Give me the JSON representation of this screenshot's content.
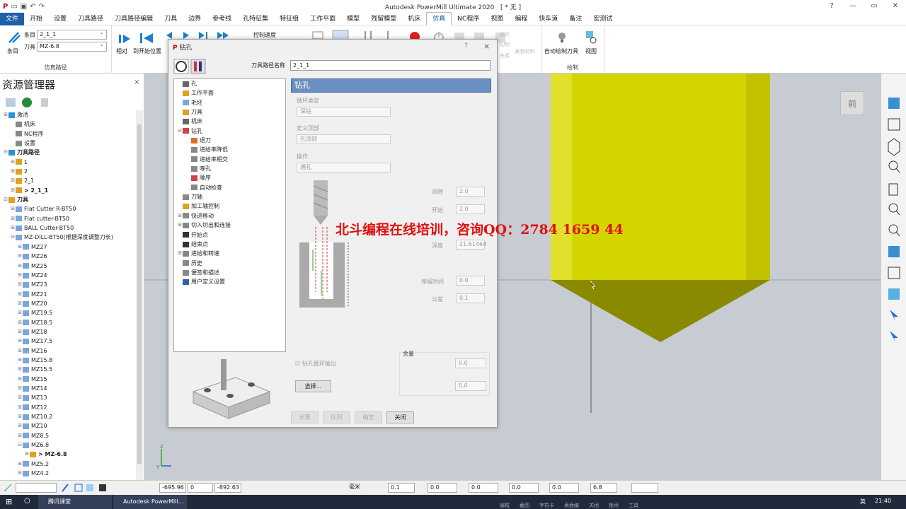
{
  "window": {
    "title": "Autodesk PowerMill Ultimate 2020",
    "doc": "[ * 无 ]"
  },
  "menu": [
    "文件",
    "开始",
    "设置",
    "刀具路径",
    "刀具路径编辑",
    "刀具",
    "边界",
    "参考线",
    "孔特征集",
    "特征组",
    "工作平面",
    "模型",
    "残留模型",
    "机床",
    "仿真",
    "NC程序",
    "视图",
    "编程",
    "快车道",
    "备注",
    "宏测试"
  ],
  "ribbon": {
    "item_label": "条目",
    "item_value": "2_1_1",
    "tool_label": "刀具",
    "tool_value": "MZ-6.8",
    "entry_btn": "条目",
    "sim_path_group": "仿真路径",
    "relative": "相对",
    "to_start": "到开始位置",
    "control_speed": "控制速度",
    "auto_draw": "自动绘制刀具",
    "view": "视图",
    "draw_group": "绘制",
    "ghost1": "操作",
    "ghost2": "切削",
    "ghost3": "刷新材料",
    "ghost4": "夹紧"
  },
  "explorer": {
    "title": "资源管理器",
    "tree": [
      {
        "indent": 0,
        "exp": "⊞",
        "label": "激活",
        "icon": "#2f8fd8"
      },
      {
        "indent": 1,
        "exp": "",
        "label": "机床",
        "icon": "#888"
      },
      {
        "indent": 1,
        "exp": "",
        "label": "NC程序",
        "icon": "#888"
      },
      {
        "indent": 1,
        "exp": "",
        "label": "设置",
        "icon": "#888"
      },
      {
        "indent": 0,
        "exp": "⊟",
        "label": "刀具路径",
        "icon": "#2f8fd8",
        "bold": true
      },
      {
        "indent": 1,
        "exp": "⊞",
        "label": "1",
        "icon": "#e0a020"
      },
      {
        "indent": 1,
        "exp": "⊞",
        "label": "2",
        "icon": "#e0a020"
      },
      {
        "indent": 1,
        "exp": "⊞",
        "label": "2_1",
        "icon": "#e0a020"
      },
      {
        "indent": 1,
        "exp": "⊞",
        "label": "> 2_1_1",
        "icon": "#e0a020",
        "bold": true
      },
      {
        "indent": 0,
        "exp": "⊟",
        "label": "刀具",
        "icon": "#e0a020",
        "bold": true
      },
      {
        "indent": 1,
        "exp": "⊞",
        "label": "Flat Cutter R-BT50",
        "icon": "#7aa6d8"
      },
      {
        "indent": 1,
        "exp": "⊞",
        "label": "Flat cutter-BT50",
        "icon": "#7aa6d8"
      },
      {
        "indent": 1,
        "exp": "⊞",
        "label": "BALL Cutter-BT50",
        "icon": "#7aa6d8"
      },
      {
        "indent": 1,
        "exp": "⊟",
        "label": "MZ-DILL-BT50(根据深度调整刀长)",
        "icon": "#7aa6d8"
      },
      {
        "indent": 2,
        "exp": "⊞",
        "label": "MZ27",
        "icon": "#7aa6d8"
      },
      {
        "indent": 2,
        "exp": "⊞",
        "label": "MZ26",
        "icon": "#7aa6d8"
      },
      {
        "indent": 2,
        "exp": "⊞",
        "label": "MZ25",
        "icon": "#7aa6d8"
      },
      {
        "indent": 2,
        "exp": "⊞",
        "label": "MZ24",
        "icon": "#7aa6d8"
      },
      {
        "indent": 2,
        "exp": "⊞",
        "label": "MZ23",
        "icon": "#7aa6d8"
      },
      {
        "indent": 2,
        "exp": "⊞",
        "label": "MZ21",
        "icon": "#7aa6d8"
      },
      {
        "indent": 2,
        "exp": "⊞",
        "label": "MZ20",
        "icon": "#7aa6d8"
      },
      {
        "indent": 2,
        "exp": "⊞",
        "label": "MZ19.5",
        "icon": "#7aa6d8"
      },
      {
        "indent": 2,
        "exp": "⊞",
        "label": "MZ18.5",
        "icon": "#7aa6d8"
      },
      {
        "indent": 2,
        "exp": "⊞",
        "label": "MZ18",
        "icon": "#7aa6d8"
      },
      {
        "indent": 2,
        "exp": "⊞",
        "label": "MZ17.5",
        "icon": "#7aa6d8"
      },
      {
        "indent": 2,
        "exp": "⊞",
        "label": "MZ16",
        "icon": "#7aa6d8"
      },
      {
        "indent": 2,
        "exp": "⊞",
        "label": "MZ15.8",
        "icon": "#7aa6d8"
      },
      {
        "indent": 2,
        "exp": "⊞",
        "label": "MZ15.5",
        "icon": "#7aa6d8"
      },
      {
        "indent": 2,
        "exp": "⊞",
        "label": "MZ15",
        "icon": "#7aa6d8"
      },
      {
        "indent": 2,
        "exp": "⊞",
        "label": "MZ14",
        "icon": "#7aa6d8"
      },
      {
        "indent": 2,
        "exp": "⊞",
        "label": "MZ13",
        "icon": "#7aa6d8"
      },
      {
        "indent": 2,
        "exp": "⊞",
        "label": "MZ12",
        "icon": "#7aa6d8"
      },
      {
        "indent": 2,
        "exp": "⊞",
        "label": "MZ10.2",
        "icon": "#7aa6d8"
      },
      {
        "indent": 2,
        "exp": "⊞",
        "label": "MZ10",
        "icon": "#7aa6d8"
      },
      {
        "indent": 2,
        "exp": "⊞",
        "label": "MZ8.5",
        "icon": "#7aa6d8"
      },
      {
        "indent": 2,
        "exp": "⊟",
        "label": "MZ6.8",
        "icon": "#7aa6d8"
      },
      {
        "indent": 3,
        "exp": "⊞",
        "label": "> MZ-6.8",
        "icon": "#e0a020",
        "bold": true
      },
      {
        "indent": 2,
        "exp": "⊞",
        "label": "MZ5.2",
        "icon": "#7aa6d8"
      },
      {
        "indent": 2,
        "exp": "⊞",
        "label": "MZ4.2",
        "icon": "#7aa6d8"
      }
    ]
  },
  "dialog": {
    "title": "钻孔",
    "path_name_label": "刀具路径名称",
    "path_name_value": "2_1_1",
    "section_title": "钻孔",
    "tree": [
      {
        "indent": 0,
        "label": "孔",
        "icon": "#666"
      },
      {
        "indent": 0,
        "label": "工作平面",
        "icon": "#e0a020"
      },
      {
        "indent": 0,
        "label": "毛坯",
        "icon": "#7aa6d8"
      },
      {
        "indent": 0,
        "label": "刀具",
        "icon": "#e0a020"
      },
      {
        "indent": 0,
        "label": "机床",
        "icon": "#666"
      },
      {
        "indent": 0,
        "label": "钻孔",
        "icon": "#c44",
        "exp": "⊟"
      },
      {
        "indent": 1,
        "label": "退刀",
        "icon": "#e07020"
      },
      {
        "indent": 1,
        "label": "进给率降低",
        "icon": "#888"
      },
      {
        "indent": 1,
        "label": "进给率相交",
        "icon": "#888"
      },
      {
        "indent": 1,
        "label": "啄孔",
        "icon": "#888"
      },
      {
        "indent": 1,
        "label": "顺序",
        "icon": "#c44"
      },
      {
        "indent": 1,
        "label": "自动检查",
        "icon": "#888"
      },
      {
        "indent": 0,
        "label": "刀轴",
        "icon": "#888"
      },
      {
        "indent": 0,
        "label": "加工轴控制",
        "icon": "#e0a020"
      },
      {
        "indent": 0,
        "label": "快进移动",
        "icon": "#888",
        "exp": "⊞"
      },
      {
        "indent": 0,
        "label": "切入切出和连接",
        "icon": "#888",
        "exp": "⊞"
      },
      {
        "indent": 0,
        "label": "开始点",
        "icon": "#333"
      },
      {
        "indent": 0,
        "label": "结束点",
        "icon": "#333"
      },
      {
        "indent": 0,
        "label": "进给和转速",
        "icon": "#888",
        "exp": "⊞"
      },
      {
        "indent": 0,
        "label": "历史",
        "icon": "#888"
      },
      {
        "indent": 0,
        "label": "便签和描述",
        "icon": "#888"
      },
      {
        "indent": 0,
        "label": "用户定义设置",
        "icon": "#2f5fa8"
      }
    ],
    "cycle_type_label": "循环类型",
    "cycle_type_value": "深钻",
    "define_top_label": "定义顶部",
    "define_top_value": "孔顶部",
    "operation_label": "操作",
    "operation_value": "通孔",
    "clearance_label": "间隙",
    "clearance_value": "2.0",
    "start_label": "开始",
    "start_value": "2.0",
    "depth_label": "深度",
    "depth_value": "21.61464",
    "dwell_label": "停留时间",
    "dwell_value": "0.0",
    "tol_label": "公差",
    "tol_value": "0.1",
    "cycle_output_label": "钻孔循环输出",
    "select_btn": "选择...",
    "allowance_title": "余量",
    "allow1": "0.0",
    "allow2": "0.0",
    "buttons": [
      "计算",
      "队列",
      "确定",
      "关闭"
    ]
  },
  "watermark": "北斗编程在线培训，咨询QQ：2784 1659 44",
  "viewport": {
    "view_label": "前"
  },
  "status": {
    "x": "-695.96",
    "y": "0",
    "z": "-892.63",
    "unit": "毫米",
    "v1": "0.1",
    "v2": "0.0",
    "v3": "0.0",
    "v4": "0.0",
    "v5": "0.0",
    "v6": "6.8"
  },
  "taskbar": {
    "app1": "腾讯课堂",
    "app2": "Autodesk PowerMill...",
    "ime": "英",
    "clock": "21:40",
    "tray_tabs": [
      "遍框",
      "截图",
      "字符卡",
      "表面编",
      "关闭",
      "锁闭",
      "工具"
    ]
  },
  "colors": {
    "accent": "#1e5fa8",
    "model": "#d4d400",
    "section": "#6b8fc0"
  }
}
